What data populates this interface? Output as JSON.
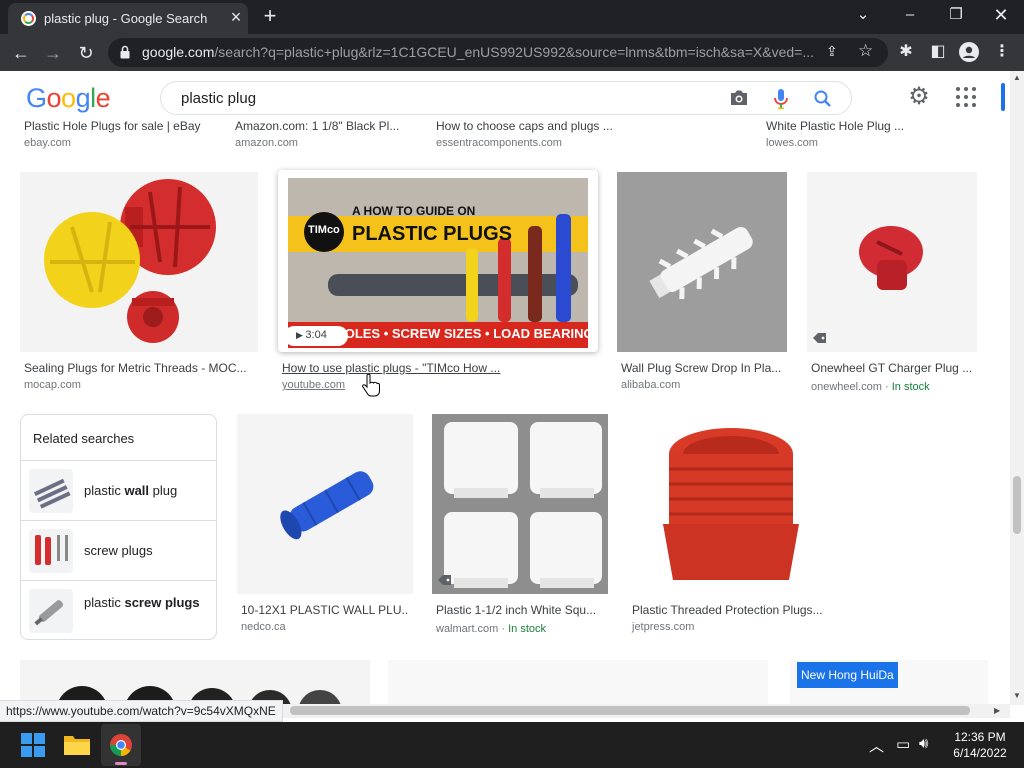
{
  "browser": {
    "tab_title": "plastic plug - Google Search",
    "url_domain": "google.com",
    "url_path": "/search?q=plastic+plug&rlz=1C1GCEU_enUS992US992&source=lnms&tbm=isch&sa=X&ved=...",
    "status_url": "https://www.youtube.com/watch?v=9c54vXMQxNE"
  },
  "google": {
    "logo_letters": [
      "G",
      "o",
      "o",
      "g",
      "l",
      "e"
    ],
    "logo_colors": [
      "#4285f4",
      "#ea4335",
      "#fbbc05",
      "#4285f4",
      "#34a853",
      "#ea4335"
    ],
    "query": "plastic plug"
  },
  "results": {
    "top_row": [
      {
        "caption": "Plastic Hole Plugs for sale | eBay",
        "source": "ebay.com"
      },
      {
        "caption": "Amazon.com: 1 1/8\" Black Pl...",
        "source": "amazon.com"
      },
      {
        "caption": "How to choose caps and plugs ...",
        "source": "essentracomponents.com"
      },
      {
        "caption": "White Plastic Hole Plug ...",
        "source": "lowes.com"
      }
    ],
    "row2": [
      {
        "caption": "Sealing Plugs for Metric Threads - MOC...",
        "source": "mocap.com"
      },
      {
        "caption": "How to use plastic plugs - \"TIMco How ...",
        "source": "youtube.com",
        "duration": "3:04",
        "banner_top": "A HOW TO GUIDE ON",
        "banner_title": "PLASTIC PLUGS",
        "brand": "TIMco",
        "banner_bottom": "L HOLES • SCREW SIZES • LOAD BEARINGS"
      },
      {
        "caption": "Wall Plug Screw Drop In Pla...",
        "source": "alibaba.com"
      },
      {
        "caption": "Onewheel GT Charger Plug ...",
        "source": "onewheel.com",
        "stock": "In stock"
      }
    ],
    "row3": [
      {
        "caption": "10-12X1 PLASTIC WALL PLU...",
        "source": "nedco.ca"
      },
      {
        "caption": "Plastic 1-1/2 inch White Squ...",
        "source": "walmart.com",
        "stock": "In stock"
      },
      {
        "caption": "Plastic Threaded Protection Plugs...",
        "source": "jetpress.com"
      }
    ],
    "ad_label": "New Hong HuiDa",
    "stock_separator": " · "
  },
  "related": {
    "title": "Related searches",
    "items": [
      {
        "pre": "plastic ",
        "bold": "wall",
        "post": " plug"
      },
      {
        "pre": "screw plugs",
        "bold": "",
        "post": ""
      },
      {
        "pre": "plastic ",
        "bold": "screw plugs",
        "post": ""
      }
    ]
  },
  "taskbar": {
    "time": "12:36 PM",
    "date": "6/14/2022"
  }
}
